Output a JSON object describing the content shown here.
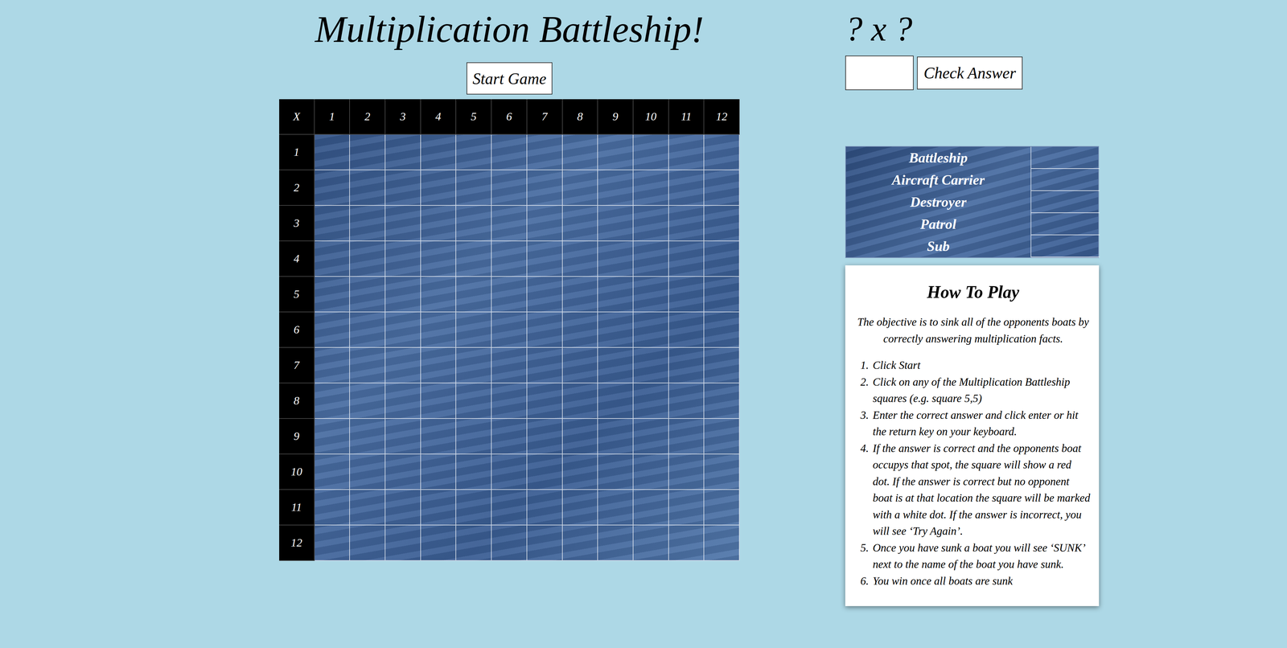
{
  "title": "Multiplication Battleship!",
  "start_button": "Start Game",
  "question": "? x ?",
  "answer_field": {
    "value": ""
  },
  "check_button": "Check Answer",
  "grid": {
    "corner": "X",
    "columns": [
      "1",
      "2",
      "3",
      "4",
      "5",
      "6",
      "7",
      "8",
      "9",
      "10",
      "11",
      "12"
    ],
    "rows": [
      "1",
      "2",
      "3",
      "4",
      "5",
      "6",
      "7",
      "8",
      "9",
      "10",
      "11",
      "12"
    ]
  },
  "ships": [
    {
      "name": "Battleship",
      "status": ""
    },
    {
      "name": "Aircraft Carrier",
      "status": ""
    },
    {
      "name": "Destroyer",
      "status": ""
    },
    {
      "name": "Patrol",
      "status": ""
    },
    {
      "name": "Sub",
      "status": ""
    }
  ],
  "how_to": {
    "heading": "How To Play",
    "intro": "The objective is to sink all of the opponents boats by correctly answering multiplication facts.",
    "steps": [
      {
        "number": "1.",
        "text": "Click Start"
      },
      {
        "number": "2.",
        "text": "Click on any of the Multiplication Battleship squares (e.g. square 5,5)"
      },
      {
        "number": "3.",
        "text": "Enter the correct answer and click enter or hit the return key on your keyboard."
      },
      {
        "number": "4.",
        "text": "If the answer is correct and the opponents boat occupys that spot, the square will show a red dot. If the answer is correct but no opponent boat is at that location the square will be marked with a white dot. If the answer is incorrect, you will see ‘Try Again’."
      },
      {
        "number": "5.",
        "text": "Once you have sunk a boat you will see ‘SUNK’ next to the name of the boat you have sunk."
      },
      {
        "number": "6.",
        "text": "You win once all boats are sunk"
      }
    ]
  }
}
